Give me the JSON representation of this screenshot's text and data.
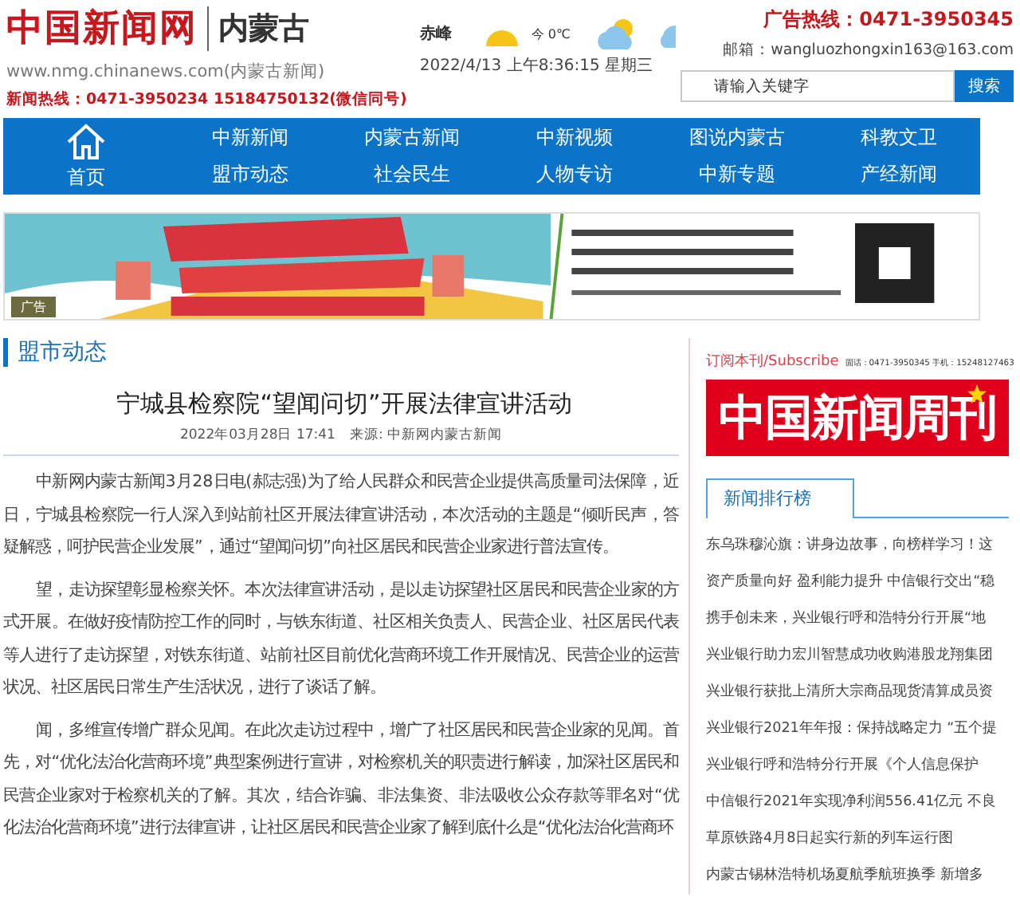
{
  "header": {
    "logo": "中国新闻网",
    "region": "内蒙古",
    "url": "www.nmg.chinanews.com(内蒙古新闻)",
    "hotline": "新闻热线：0471-3950234 15184750132(微信同号)",
    "weather": {
      "city": "赤峰",
      "temp": "今 0℃",
      "datetime": "2022/4/13 上午8:36:15 星期三"
    },
    "ad_hotline": "广告热线：0471-3950345",
    "email": "邮箱：wangluozhongxin163@163.com",
    "search": {
      "placeholder": "请输入关键字",
      "button": "搜索"
    }
  },
  "nav": {
    "home": "首页",
    "rows": [
      [
        "中新新闻",
        "内蒙古新闻",
        "中新视频",
        "图说内蒙古",
        "科教文卫"
      ],
      [
        "盟市动态",
        "社会民生",
        "人物专访",
        "中新专题",
        "产经新闻"
      ]
    ]
  },
  "banner": {
    "kind": "picture",
    "tag": "广告"
  },
  "section": "盟市动态",
  "article": {
    "title": "宁城县检察院“望闻问切”开展法律宣讲活动",
    "meta": "2022年03月28日 17:41　来源: 中新网内蒙古新闻",
    "paragraphs": [
      "中新网内蒙古新闻3月28日电(郝志强)为了给人民群众和民营企业提供高质量司法保障，近日，宁城县检察院一行人深入到站前社区开展法律宣讲活动，本次活动的主题是“倾听民声，答疑解惑，呵护民营企业发展”，通过“望闻问切”向社区居民和民营企业家进行普法宣传。",
      "望，走访探望彰显检察关怀。本次法律宣讲活动，是以走访探望社区居民和民营企业家的方式开展。在做好疫情防控工作的同时，与铁东街道、社区相关负责人、民营企业、社区居民代表等人进行了走访探望，对铁东街道、站前社区目前优化营商环境工作开展情况、民营企业的运营状况、社区居民日常生产生活状况，进行了谈话了解。",
      "闻，多维宣传增广群众见闻。在此次走访过程中，增广了社区居民和民营企业家的见闻。首先，对“优化法治化营商环境”典型案例进行宣讲，对检察机关的职责进行解读，加深社区居民和民营企业家对于检察机关的了解。其次，结合诈骗、非法集资、非法吸收公众存款等罪名对“优化法治化营商环境”进行法律宣讲，让社区居民和民营企业家了解到底什么是“优化法治化营商环"
    ]
  },
  "sidebar": {
    "subscribe": "订阅本刊/Subscribe",
    "contact": "固话：0471-3950345 手机：15248127463",
    "magazine": "中国新闻周刊",
    "ranking_title": "新闻排行榜",
    "ranking": [
      "东乌珠穆沁旗：讲身边故事，向榜样学习！这",
      "资产质量向好 盈利能力提升 中信银行交出“稳",
      "携手创未来，兴业银行呼和浩特分行开展“地",
      "兴业银行助力宏川智慧成功收购港股龙翔集团",
      "兴业银行获批上清所大宗商品现货清算成员资",
      "兴业银行2021年年报：保持战略定力 “五个提",
      "兴业银行呼和浩特分行开展《个人信息保护",
      "中信银行2021年实现净利润556.41亿元 不良",
      "草原铁路4月8日起实行新的列车运行图",
      "内蒙古锡林浩特机场夏航季航班换季 新增多"
    ]
  }
}
